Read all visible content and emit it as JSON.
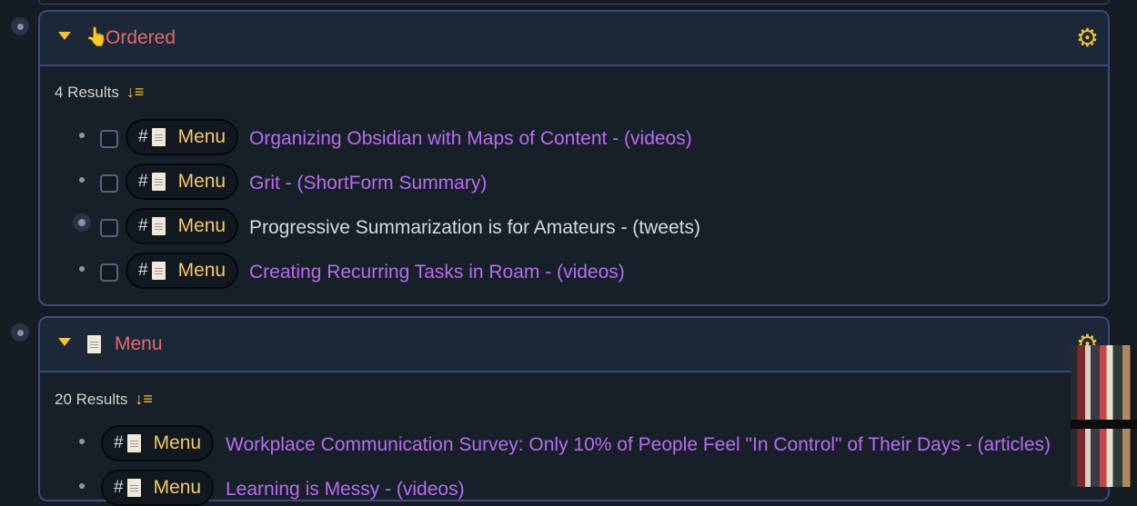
{
  "panels": [
    {
      "title": "Ordered",
      "header_icon": "pointer-hand-icon",
      "results_label": "4 Results",
      "rows": [
        {
          "tag": "Menu",
          "title": "Organizing Obsidian with Maps of Content - (videos)",
          "is_link": true
        },
        {
          "tag": "Menu",
          "title": "Grit - (ShortForm Summary)",
          "is_link": true
        },
        {
          "tag": "Menu",
          "title": "Progressive Summarization is for Amateurs - (tweets)",
          "is_link": false
        },
        {
          "tag": "Menu",
          "title": "Creating Recurring Tasks in Roam - (videos)",
          "is_link": true
        }
      ]
    },
    {
      "title": "Menu",
      "header_icon": "document-icon",
      "results_label": "20 Results",
      "rows": [
        {
          "tag": "Menu",
          "title": "Workplace Communication Survey: Only 10% of People Feel \"In Control\" of Their Days - (articles)",
          "is_link": true
        },
        {
          "tag": "Menu",
          "title": "Learning is Messy - (videos)",
          "is_link": true
        }
      ]
    }
  ],
  "tag_prefix": "#",
  "colors": {
    "background": "#161c24",
    "panel_border": "#414878",
    "header_title": "#e06c6c",
    "link": "#b86bf0",
    "accent": "#f1c040",
    "tag_text": "#f3c96b"
  }
}
